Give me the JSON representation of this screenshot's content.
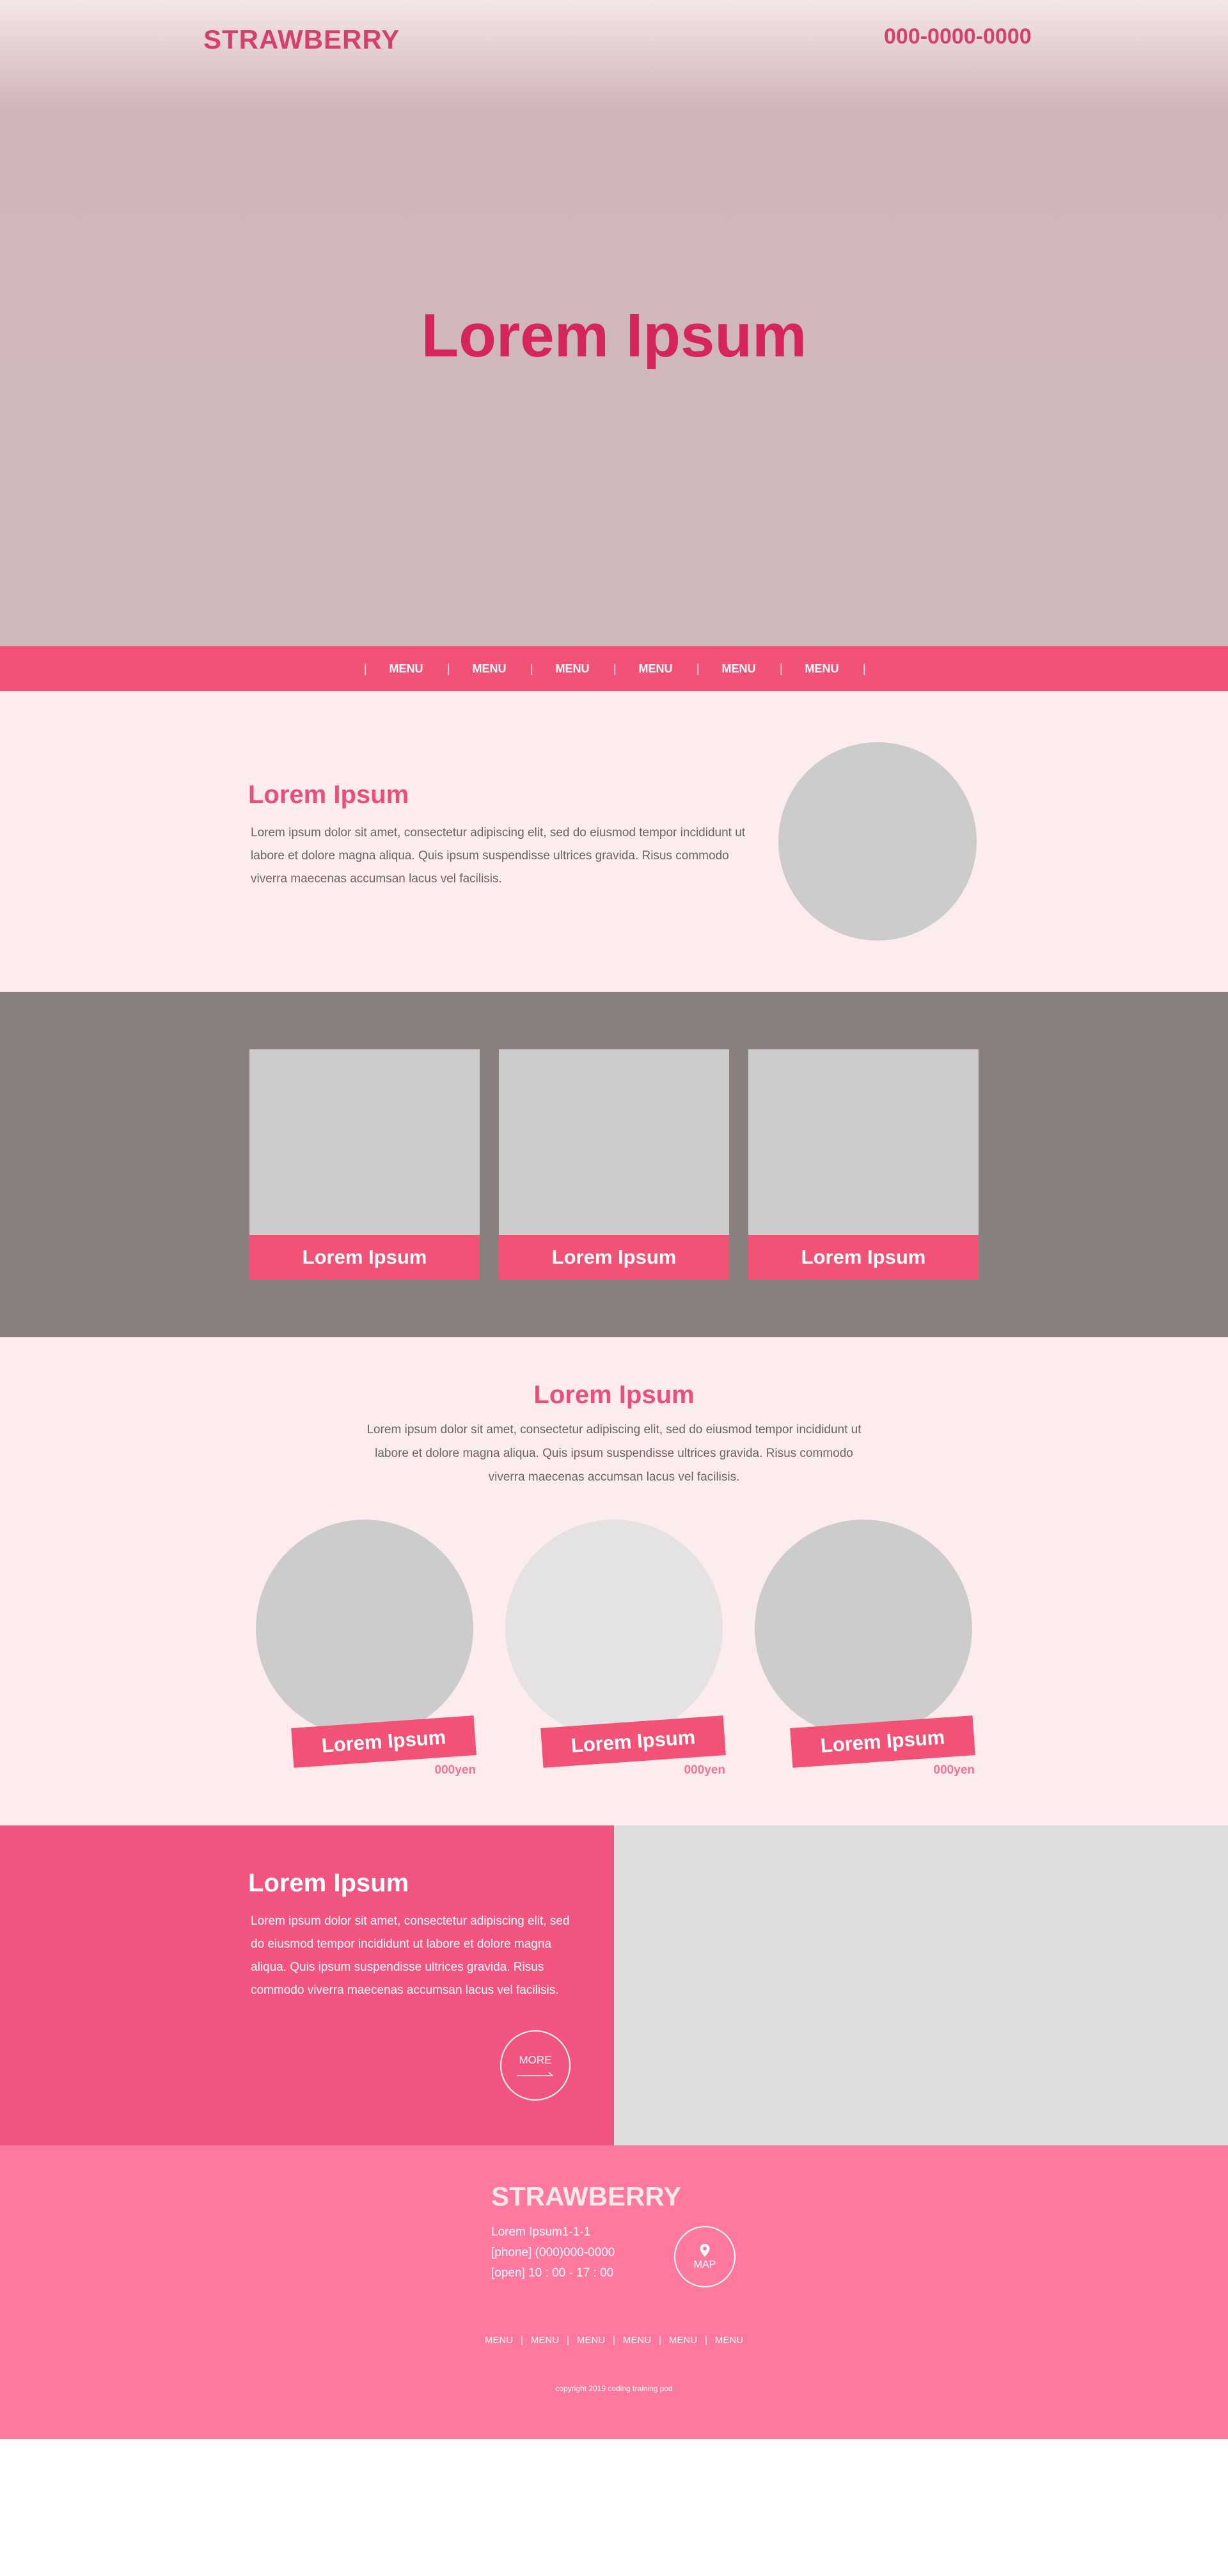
{
  "header": {
    "brand": "STRAWBERRY",
    "phone": "000-0000-0000"
  },
  "hero": {
    "title": "Lorem Ipsum"
  },
  "nav": {
    "separator": "|",
    "items": [
      "MENU",
      "MENU",
      "MENU",
      "MENU",
      "MENU",
      "MENU"
    ]
  },
  "intro": {
    "title": "Lorem Ipsum",
    "text": "Lorem ipsum dolor sit amet, consectetur adipiscing elit, sed do eiusmod tempor incididunt ut labore et dolore magna aliqua. Quis ipsum suspendisse ultrices gravida. Risus commodo viverra maecenas accumsan lacus vel facilisis."
  },
  "cards": {
    "items": [
      {
        "label": "Lorem Ipsum"
      },
      {
        "label": "Lorem Ipsum"
      },
      {
        "label": "Lorem Ipsum"
      }
    ]
  },
  "products": {
    "title": "Lorem Ipsum",
    "text": "Lorem ipsum dolor sit amet, consectetur adipiscing elit, sed do eiusmod tempor incididunt ut labore et dolore magna aliqua. Quis ipsum suspendisse ultrices gravida. Risus commodo viverra maecenas accumsan lacus vel facilisis.",
    "items": [
      {
        "label": "Lorem Ipsum",
        "price": "000yen"
      },
      {
        "label": "Lorem Ipsum",
        "price": "000yen"
      },
      {
        "label": "Lorem Ipsum",
        "price": "000yen"
      }
    ]
  },
  "feature": {
    "title": "Lorem Ipsum",
    "text": "Lorem ipsum dolor sit amet, consectetur adipiscing elit, sed do eiusmod tempor incididunt ut labore et dolore magna aliqua. Quis ipsum suspendisse ultrices gravida. Risus commodo viverra maecenas accumsan lacus vel facilisis.",
    "more_label": "MORE"
  },
  "footer": {
    "brand": "STRAWBERRY",
    "address": "Lorem Ipsum1-1-1",
    "phone": "[phone] (000)000-0000",
    "hours": "[open] 10 : 00 - 17 : 00",
    "map_label": "MAP",
    "nav_separator": "|",
    "nav_items": [
      "MENU",
      "MENU",
      "MENU",
      "MENU",
      "MENU",
      "MENU"
    ],
    "copyright": "copyright 2019 coding training pod"
  },
  "colors": {
    "accent": "#f25275",
    "brand_text": "#d4416c",
    "hero_title": "#d4255c",
    "section_bg": "#fdeced",
    "cards_bg": "#897f7e",
    "footer_bg": "#ff789d",
    "placeholder": "#cccccc"
  }
}
